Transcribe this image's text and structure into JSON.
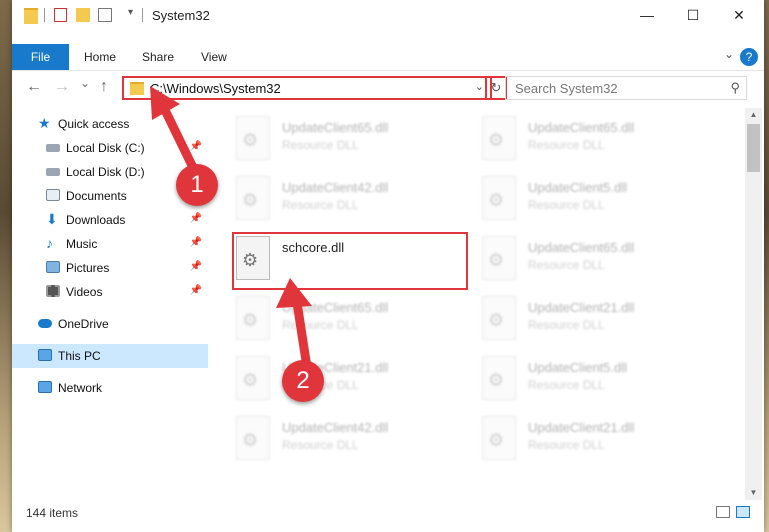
{
  "window": {
    "title": "System32",
    "quick_access_toolbar": [
      "folder-icon",
      "properties-icon",
      "new-folder-icon",
      "customize-icon"
    ]
  },
  "ribbon": {
    "tabs": [
      "File",
      "Home",
      "Share",
      "View"
    ],
    "help_label": "?"
  },
  "nav": {
    "back": "←",
    "forward": "→",
    "recent": "⌄",
    "up": "↑",
    "address": "C:\\Windows\\System32",
    "refresh": "↻",
    "search_placeholder": "Search System32"
  },
  "sidebar": {
    "items": [
      {
        "label": "Quick access",
        "icon": "star-icon",
        "pinned": false,
        "selected": false
      },
      {
        "label": "Local Disk (C:)",
        "icon": "drive-icon",
        "pinned": true,
        "selected": false
      },
      {
        "label": "Local Disk (D:)",
        "icon": "drive-icon",
        "pinned": false,
        "selected": false
      },
      {
        "label": "Documents",
        "icon": "documents-icon",
        "pinned": true,
        "selected": false
      },
      {
        "label": "Downloads",
        "icon": "download-icon",
        "pinned": true,
        "selected": false
      },
      {
        "label": "Music",
        "icon": "music-icon",
        "pinned": true,
        "selected": false
      },
      {
        "label": "Pictures",
        "icon": "pictures-icon",
        "pinned": true,
        "selected": false
      },
      {
        "label": "Videos",
        "icon": "videos-icon",
        "pinned": true,
        "selected": false
      },
      {
        "label": "OneDrive",
        "icon": "cloud-icon",
        "pinned": false,
        "selected": false
      },
      {
        "label": "This PC",
        "icon": "computer-icon",
        "pinned": false,
        "selected": true
      },
      {
        "label": "Network",
        "icon": "network-icon",
        "pinned": false,
        "selected": false
      }
    ]
  },
  "files": [
    {
      "name": "UpdateClient65.dll",
      "type": "Resource DLL",
      "blurred": true
    },
    {
      "name": "UpdateClient65.dll",
      "type": "Resource DLL",
      "blurred": true
    },
    {
      "name": "UpdateClient42.dll",
      "type": "Resource DLL",
      "blurred": true
    },
    {
      "name": "UpdateClient5.dll",
      "type": "Resource DLL",
      "blurred": true
    },
    {
      "name": "schcore.dll",
      "type": "",
      "blurred": false
    },
    {
      "name": "UpdateClient65.dll",
      "type": "Resource DLL",
      "blurred": true
    },
    {
      "name": "UpdateClient65.dll",
      "type": "Resource DLL",
      "blurred": true
    },
    {
      "name": "UpdateClient21.dll",
      "type": "Resource DLL",
      "blurred": true
    },
    {
      "name": "UpdateClient21.dll",
      "type": "Resource DLL",
      "blurred": true
    },
    {
      "name": "UpdateClient5.dll",
      "type": "Resource DLL",
      "blurred": true
    },
    {
      "name": "UpdateClient42.dll",
      "type": "Resource DLL",
      "blurred": true
    },
    {
      "name": "UpdateClient21.dll",
      "type": "Resource DLL",
      "blurred": true
    }
  ],
  "status": {
    "item_count": "144 items"
  },
  "annotations": {
    "step1": "1",
    "step2": "2",
    "highlight_color": "#e0363b"
  },
  "colors": {
    "accent": "#1979ca",
    "selected_bg": "#cce8ff"
  }
}
